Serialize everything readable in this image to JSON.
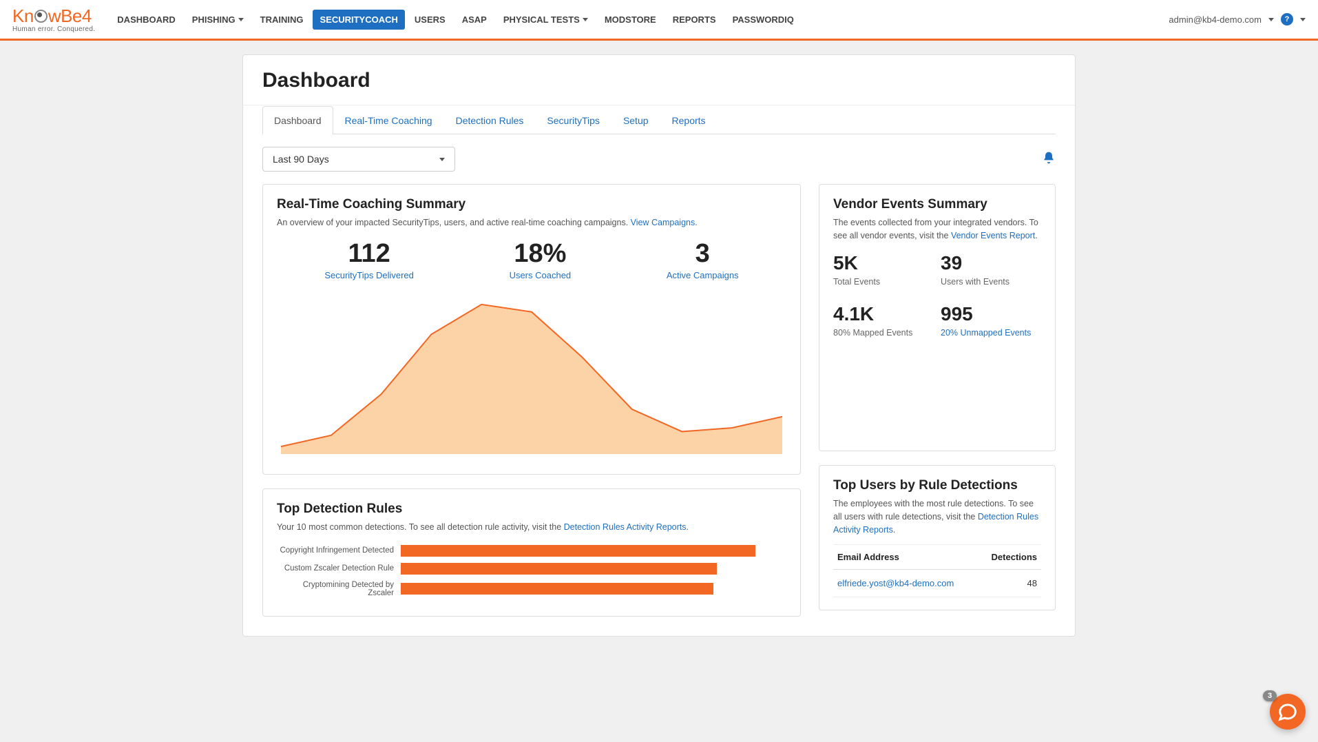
{
  "logo": {
    "text_pre": "Kn",
    "text_post": "wBe4",
    "tag": "Human error. Conquered."
  },
  "nav": {
    "items": [
      "DASHBOARD",
      "PHISHING",
      "TRAINING",
      "SECURITYCOACH",
      "USERS",
      "ASAP",
      "PHYSICAL TESTS",
      "MODSTORE",
      "REPORTS",
      "PASSWORDIQ"
    ],
    "dropdown_flags": [
      false,
      true,
      false,
      false,
      false,
      false,
      true,
      false,
      false,
      false
    ],
    "active_index": 3
  },
  "user": {
    "email": "admin@kb4-demo.com",
    "help": "?"
  },
  "page": {
    "title": "Dashboard"
  },
  "tabs": {
    "items": [
      "Dashboard",
      "Real-Time Coaching",
      "Detection Rules",
      "SecurityTips",
      "Setup",
      "Reports"
    ],
    "active_index": 0
  },
  "filter": {
    "selected": "Last 90 Days"
  },
  "rtc_summary": {
    "title": "Real-Time Coaching Summary",
    "sub_pre": "An overview of your impacted SecurityTips, users, and active real-time coaching campaigns. ",
    "sub_link": "View Campaigns",
    "sub_post": ".",
    "stats": [
      {
        "value": "112",
        "label": "SecurityTips Delivered"
      },
      {
        "value": "18%",
        "label": "Users Coached"
      },
      {
        "value": "3",
        "label": "Active Campaigns"
      }
    ]
  },
  "vendor_summary": {
    "title": "Vendor Events Summary",
    "sub_pre": "The events collected from your integrated vendors. To see all vendor events, visit the ",
    "sub_link": "Vendor Events Report",
    "sub_post": ".",
    "stats": [
      {
        "value": "5K",
        "label": "Total Events",
        "link": false
      },
      {
        "value": "39",
        "label": "Users with Events",
        "link": false
      },
      {
        "value": "4.1K",
        "label": "80% Mapped Events",
        "link": false
      },
      {
        "value": "995",
        "label": "20% Unmapped Events",
        "link": true
      }
    ]
  },
  "top_rules": {
    "title": "Top Detection Rules",
    "sub_pre": "Your 10 most common detections. To see all detection rule activity, visit the ",
    "sub_link": "Detection Rules Activity Reports",
    "sub_post": "."
  },
  "top_users": {
    "title": "Top Users by Rule Detections",
    "sub_pre": "The employees with the most rule detections. To see all users with rule detections, visit the ",
    "sub_link": "Detection Rules Activity Reports",
    "sub_post": ".",
    "col1": "Email Address",
    "col2": "Detections",
    "rows": [
      {
        "email": "elfriede.yost@kb4-demo.com",
        "count": "48"
      }
    ]
  },
  "fab": {
    "badge": "3"
  },
  "chart_data": [
    {
      "type": "area",
      "title": "Real-Time Coaching Summary",
      "x": [
        0,
        1,
        2,
        3,
        4,
        5,
        6,
        7,
        8,
        9,
        10
      ],
      "values": [
        10,
        25,
        80,
        160,
        200,
        190,
        130,
        60,
        30,
        35,
        50
      ],
      "ylim": [
        0,
        210
      ],
      "stroke": "#f26724",
      "fill": "#fbd3a6"
    },
    {
      "type": "bar",
      "title": "Top Detection Rules",
      "orientation": "horizontal",
      "categories": [
        "Copyright Infringement Detected",
        "Custom Zscaler Detection Rule",
        "Cryptomining Detected by Zscaler"
      ],
      "values": [
        92,
        82,
        81
      ],
      "xlim": [
        0,
        100
      ],
      "bar_color": "#f26724"
    }
  ]
}
